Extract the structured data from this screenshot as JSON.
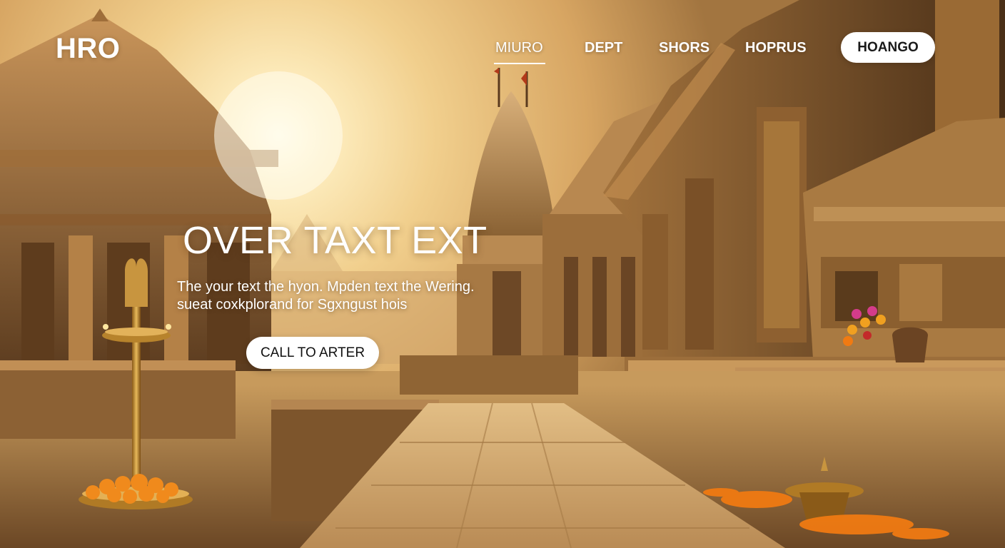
{
  "brand": {
    "logo_text": "HRO"
  },
  "nav": {
    "items": [
      {
        "label": "MIURO",
        "active": true
      },
      {
        "label": "DEPT",
        "active": false
      },
      {
        "label": "SHORS",
        "active": false
      },
      {
        "label": "HOPRUS",
        "active": false
      }
    ],
    "cta_label": "HOANGO"
  },
  "hero": {
    "headline": "OVER TAXT EXT",
    "subtext_lines": [
      "The your text the hyon. Mpden text the Wering.",
      "sueat coxkplorand for Sgxngust hois"
    ],
    "cta_label": "CALL TO ARTER"
  },
  "theme": {
    "accent": "#ffffff",
    "sky_glow": "#fff4cf",
    "stone": "#a97c46",
    "marigold": "#f08a1c"
  }
}
